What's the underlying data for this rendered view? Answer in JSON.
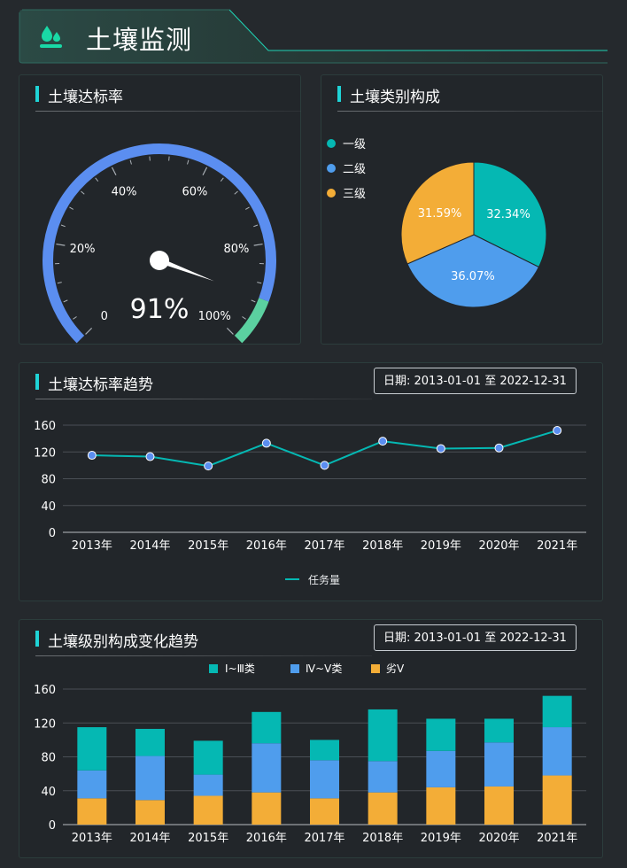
{
  "header": {
    "title": "土壤监测",
    "logo_icon": "water-drop-icon"
  },
  "gauge_panel": {
    "title": "土壤达标率",
    "value_label": "91%",
    "ticks": [
      "0",
      "20%",
      "40%",
      "60%",
      "80%",
      "100%"
    ],
    "value": 91
  },
  "pie_panel": {
    "title": "土壤类别构成",
    "legend": [
      "一级",
      "二级",
      "三级"
    ],
    "labels": [
      "32.34%",
      "36.07%",
      "31.59%"
    ]
  },
  "trend_panel": {
    "title": "土壤达标率趋势",
    "date_label": "日期: 2013-01-01 至 2022-12-31",
    "legend_label": "任务量",
    "y_ticks": [
      "0",
      "40",
      "80",
      "120",
      "160"
    ],
    "x_ticks": [
      "2013年",
      "2014年",
      "2015年",
      "2016年",
      "2017年",
      "2018年",
      "2019年",
      "2020年",
      "2021年"
    ]
  },
  "stack_panel": {
    "title": "土壤级别构成变化趋势",
    "date_label": "日期: 2013-01-01 至 2022-12-31",
    "legend": [
      "Ⅰ~Ⅲ类",
      "Ⅳ~Ⅴ类",
      "劣Ⅴ"
    ],
    "y_ticks": [
      "0",
      "40",
      "80",
      "120",
      "160"
    ],
    "x_ticks": [
      "2013年",
      "2014年",
      "2015年",
      "2016年",
      "2017年",
      "2018年",
      "2019年",
      "2020年",
      "2021年"
    ]
  },
  "colors": {
    "accent": "#1fd3d6",
    "teal": "#05b8b3",
    "blue": "#4f9ded",
    "orange": "#f3ad37",
    "gauge_blue": "#5b8ef0",
    "gauge_green": "#5bd0a0"
  },
  "chart_data": [
    {
      "type": "gauge",
      "title": "土壤达标率",
      "value": 91,
      "range": [
        0,
        100
      ],
      "tick_labels": [
        "0",
        "20%",
        "40%",
        "60%",
        "80%",
        "100%"
      ]
    },
    {
      "type": "pie",
      "title": "土壤类别构成",
      "categories": [
        "一级",
        "二级",
        "三级"
      ],
      "values": [
        32.34,
        36.07,
        31.59
      ],
      "legend": "top-left"
    },
    {
      "type": "line",
      "title": "土壤达标率趋势",
      "categories": [
        "2013年",
        "2014年",
        "2015年",
        "2016年",
        "2017年",
        "2018年",
        "2019年",
        "2020年",
        "2021年"
      ],
      "series": [
        {
          "name": "任务量",
          "values": [
            115,
            113,
            99,
            133,
            100,
            136,
            125,
            126,
            152
          ]
        }
      ],
      "ylim": [
        0,
        160
      ],
      "grid": true,
      "legend": "bottom-center"
    },
    {
      "type": "bar",
      "stacked": true,
      "title": "土壤级别构成变化趋势",
      "categories": [
        "2013年",
        "2014年",
        "2015年",
        "2016年",
        "2017年",
        "2018年",
        "2019年",
        "2020年",
        "2021年"
      ],
      "series": [
        {
          "name": "劣Ⅴ",
          "values": [
            31,
            29,
            34,
            38,
            31,
            38,
            44,
            45,
            58
          ]
        },
        {
          "name": "Ⅳ~Ⅴ类",
          "values": [
            33,
            52,
            25,
            58,
            45,
            37,
            43,
            52,
            57
          ]
        },
        {
          "name": "Ⅰ~Ⅲ类",
          "values": [
            51,
            32,
            40,
            37,
            24,
            61,
            38,
            28,
            37
          ]
        }
      ],
      "ylim": [
        0,
        160
      ],
      "grid": true,
      "legend": "top-center"
    }
  ]
}
